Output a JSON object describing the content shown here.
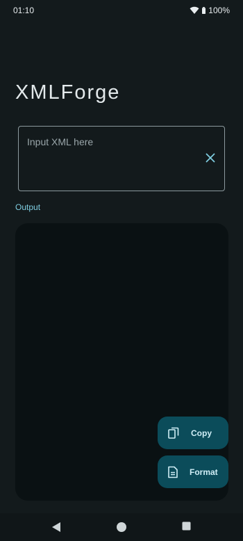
{
  "status_bar": {
    "time": "01:10",
    "battery": "100%",
    "icons": [
      "wifi-icon",
      "battery-icon"
    ]
  },
  "app": {
    "title": "XMLForge"
  },
  "input": {
    "placeholder": "Input XML here",
    "value": ""
  },
  "output": {
    "label": "Output",
    "content": ""
  },
  "actions": {
    "copy_label": "Copy",
    "format_label": "Format"
  },
  "navigation": {
    "buttons": [
      "back",
      "home",
      "recents"
    ]
  },
  "colors": {
    "background": "#131a1c",
    "accent": "#7fcde0",
    "fab": "#0b4c5a",
    "output_panel": "#0a1113"
  }
}
